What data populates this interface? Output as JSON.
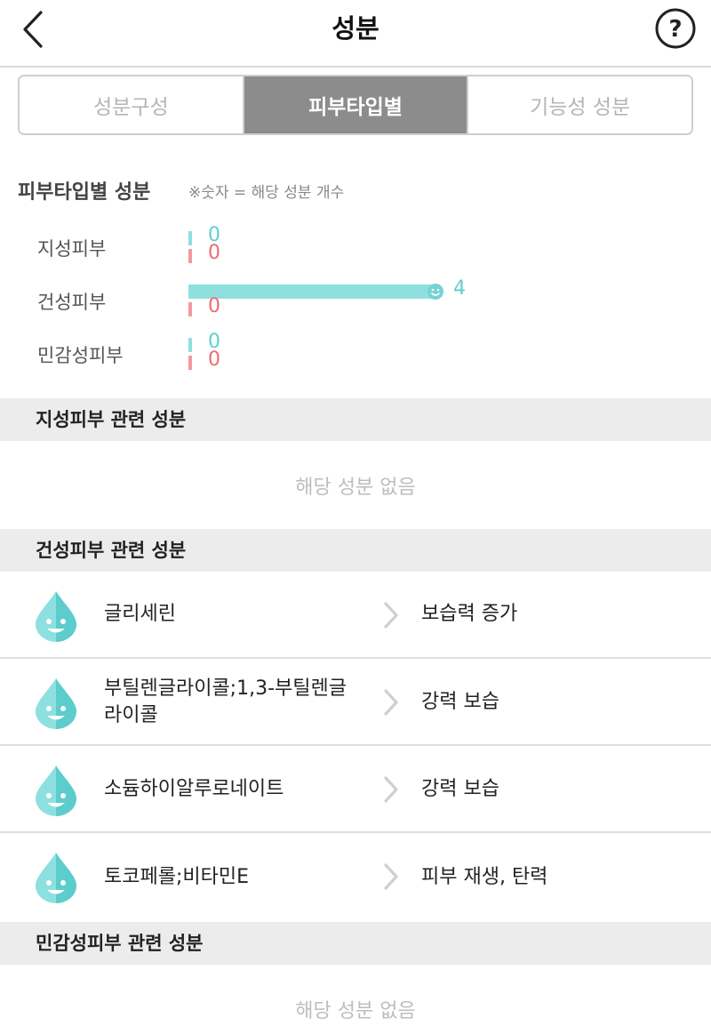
{
  "header": {
    "title": "성분"
  },
  "tabs": [
    {
      "label": "성분구성",
      "active": false
    },
    {
      "label": "피부타입별",
      "active": true
    },
    {
      "label": "기능성 성분",
      "active": false
    }
  ],
  "summary": {
    "title": "피부타입별 성분",
    "note": "※숫자 = 해당 성분 개수",
    "max_count": 4,
    "rows": [
      {
        "label": "지성피부",
        "good": 0,
        "bad": 0,
        "good_text": "0",
        "bad_text": "0"
      },
      {
        "label": "건성피부",
        "good": 4,
        "bad": 0,
        "good_text": "4",
        "bad_text": "0"
      },
      {
        "label": "민감성피부",
        "good": 0,
        "bad": 0,
        "good_text": "0",
        "bad_text": "0"
      }
    ]
  },
  "sections": {
    "oily": {
      "title": "지성피부 관련 성분",
      "empty": "해당 성분 없음"
    },
    "dry": {
      "title": "건성피부 관련 성분",
      "items": [
        {
          "name": "글리세린",
          "effect": "보습력 증가"
        },
        {
          "name": "부틸렌글라이콜;1,3-부틸렌글라이콜",
          "effect": "강력 보습"
        },
        {
          "name": "소듐하이알루로네이트",
          "effect": "강력 보습"
        },
        {
          "name": "토코페롤;비타민E",
          "effect": "피부 재생, 탄력"
        }
      ]
    },
    "sensitive": {
      "title": "민감성피부 관련 성분",
      "empty": "해당 성분 없음"
    }
  },
  "colors": {
    "good": "#8fdfdf",
    "good_text": "#5fcfcf",
    "bad": "#f2999e",
    "bad_text": "#ef6b72",
    "active_tab": "#8c8c8c"
  },
  "icons": {
    "back": "chevron-left-icon",
    "help": "help-circle-icon",
    "ingredient": "smiling-water-drop-icon",
    "row_arrow": "chevron-right-icon"
  }
}
